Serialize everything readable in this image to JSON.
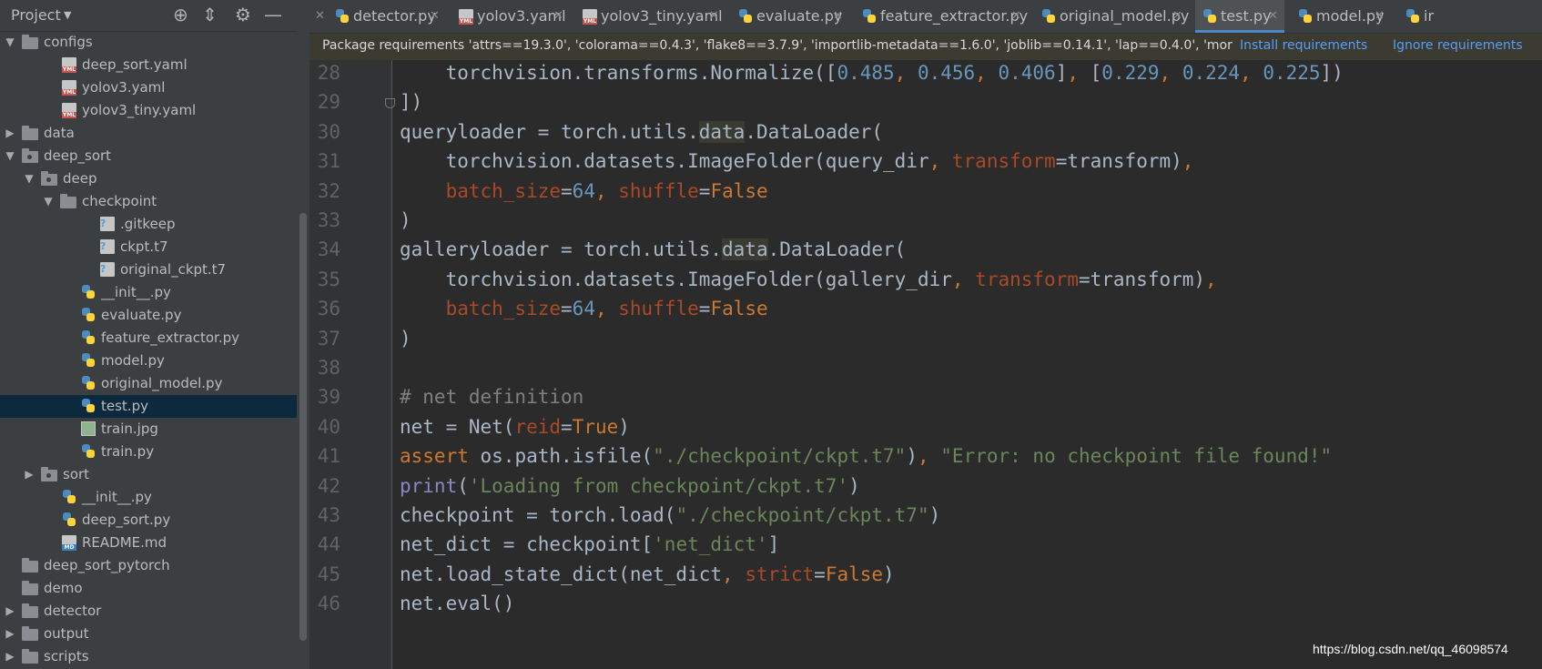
{
  "sidebar": {
    "title": "Project",
    "tree": [
      {
        "label": "configs",
        "type": "folder",
        "expanded": true
      },
      {
        "label": "deep_sort.yaml",
        "type": "yaml"
      },
      {
        "label": "yolov3.yaml",
        "type": "yaml"
      },
      {
        "label": "yolov3_tiny.yaml",
        "type": "yaml"
      },
      {
        "label": "data",
        "type": "folder",
        "expanded": false
      },
      {
        "label": "deep_sort",
        "type": "package",
        "expanded": true
      },
      {
        "label": "deep",
        "type": "package",
        "expanded": true
      },
      {
        "label": "checkpoint",
        "type": "folder",
        "expanded": true
      },
      {
        "label": ".gitkeep",
        "type": "unknown"
      },
      {
        "label": "ckpt.t7",
        "type": "unknown"
      },
      {
        "label": "original_ckpt.t7",
        "type": "unknown"
      },
      {
        "label": "__init__.py",
        "type": "python"
      },
      {
        "label": "evaluate.py",
        "type": "python"
      },
      {
        "label": "feature_extractor.py",
        "type": "python"
      },
      {
        "label": "model.py",
        "type": "python"
      },
      {
        "label": "original_model.py",
        "type": "python"
      },
      {
        "label": "test.py",
        "type": "python",
        "selected": true
      },
      {
        "label": "train.jpg",
        "type": "image"
      },
      {
        "label": "train.py",
        "type": "python"
      },
      {
        "label": "sort",
        "type": "package",
        "expanded": false
      },
      {
        "label": "__init__.py",
        "type": "python"
      },
      {
        "label": "deep_sort.py",
        "type": "python"
      },
      {
        "label": "README.md",
        "type": "markdown"
      },
      {
        "label": "deep_sort_pytorch",
        "type": "folder"
      },
      {
        "label": "demo",
        "type": "folder"
      },
      {
        "label": "detector",
        "type": "folder",
        "expanded": false
      },
      {
        "label": "output",
        "type": "folder",
        "expanded": false
      },
      {
        "label": "scripts",
        "type": "folder",
        "expanded": false
      }
    ]
  },
  "tabs": [
    {
      "label": "detector.py",
      "type": "python"
    },
    {
      "label": "yolov3.yaml",
      "type": "yaml"
    },
    {
      "label": "yolov3_tiny.yaml",
      "type": "yaml"
    },
    {
      "label": "evaluate.py",
      "type": "python"
    },
    {
      "label": "feature_extractor.py",
      "type": "python"
    },
    {
      "label": "original_model.py",
      "type": "python"
    },
    {
      "label": "test.py",
      "type": "python",
      "active": true
    },
    {
      "label": "model.py",
      "type": "python"
    },
    {
      "label": "ir",
      "type": "python"
    }
  ],
  "banner": {
    "text": "Package requirements 'attrs==19.3.0', 'colorama==0.4.3', 'flake8==3.7.9', 'importlib-metadata==1.6.0', 'joblib==0.14.1', 'lap==0.4.0', 'mor",
    "install": "Install requirements",
    "ignore": "Ignore requirements"
  },
  "code": {
    "lines": [
      {
        "n": "28",
        "tokens": [
          [
            "",
            "    torchvision.transforms.Normalize(["
          ],
          [
            "num",
            "0.485"
          ],
          [
            "kw",
            ", "
          ],
          [
            "num",
            "0.456"
          ],
          [
            "kw",
            ", "
          ],
          [
            "num",
            "0.406"
          ],
          [
            "",
            "]"
          ],
          [
            "kw",
            ", "
          ],
          [
            "",
            "["
          ],
          [
            "num",
            "0.229"
          ],
          [
            "kw",
            ", "
          ],
          [
            "num",
            "0.224"
          ],
          [
            "kw",
            ", "
          ],
          [
            "num",
            "0.225"
          ],
          [
            "",
            "])"
          ]
        ]
      },
      {
        "n": "29",
        "tokens": [
          [
            "",
            "])"
          ]
        ]
      },
      {
        "n": "30",
        "tokens": [
          [
            "",
            "queryloader = torch.utils."
          ],
          [
            "hl",
            "data"
          ],
          [
            "",
            ".DataLoader("
          ]
        ]
      },
      {
        "n": "31",
        "tokens": [
          [
            "",
            "    torchvision.datasets.ImageFolder(query_dir"
          ],
          [
            "kw",
            ", "
          ],
          [
            "kwarg",
            "transform"
          ],
          [
            "",
            "=transform)"
          ],
          [
            "kw",
            ","
          ]
        ]
      },
      {
        "n": "32",
        "tokens": [
          [
            "kwarg",
            "    batch_size"
          ],
          [
            "",
            "="
          ],
          [
            "num",
            "64"
          ],
          [
            "kw",
            ", "
          ],
          [
            "kwarg",
            "shuffle"
          ],
          [
            "",
            "="
          ],
          [
            "kw",
            "False"
          ]
        ]
      },
      {
        "n": "33",
        "tokens": [
          [
            "",
            ")"
          ]
        ]
      },
      {
        "n": "34",
        "tokens": [
          [
            "",
            "galleryloader = torch.utils."
          ],
          [
            "hl",
            "data"
          ],
          [
            "",
            ".DataLoader("
          ]
        ]
      },
      {
        "n": "35",
        "tokens": [
          [
            "",
            "    torchvision.datasets.ImageFolder(gallery_dir"
          ],
          [
            "kw",
            ", "
          ],
          [
            "kwarg",
            "transform"
          ],
          [
            "",
            "=transform)"
          ],
          [
            "kw",
            ","
          ]
        ]
      },
      {
        "n": "36",
        "tokens": [
          [
            "kwarg",
            "    batch_size"
          ],
          [
            "",
            "="
          ],
          [
            "num",
            "64"
          ],
          [
            "kw",
            ", "
          ],
          [
            "kwarg",
            "shuffle"
          ],
          [
            "",
            "="
          ],
          [
            "kw",
            "False"
          ]
        ]
      },
      {
        "n": "37",
        "tokens": [
          [
            "",
            ")"
          ]
        ]
      },
      {
        "n": "38",
        "tokens": []
      },
      {
        "n": "39",
        "tokens": [
          [
            "cmt",
            "# net definition"
          ]
        ]
      },
      {
        "n": "40",
        "tokens": [
          [
            "",
            "net = Net("
          ],
          [
            "kwarg",
            "reid"
          ],
          [
            "",
            "="
          ],
          [
            "kw",
            "True"
          ],
          [
            "",
            ")"
          ]
        ]
      },
      {
        "n": "41",
        "tokens": [
          [
            "kw",
            "assert "
          ],
          [
            "",
            "os.path.isfile("
          ],
          [
            "str",
            "\"./checkpoint/ckpt.t7\""
          ],
          [
            "",
            ")"
          ],
          [
            "kw",
            ", "
          ],
          [
            "str",
            "\"Error: no checkpoint file found!\""
          ]
        ]
      },
      {
        "n": "42",
        "tokens": [
          [
            "bi",
            "print"
          ],
          [
            "",
            "("
          ],
          [
            "str",
            "'Loading from checkpoint/ckpt.t7'"
          ],
          [
            "",
            ")"
          ]
        ]
      },
      {
        "n": "43",
        "tokens": [
          [
            "",
            "checkpoint = torch.load("
          ],
          [
            "str",
            "\"./checkpoint/ckpt.t7\""
          ],
          [
            "",
            ")"
          ]
        ]
      },
      {
        "n": "44",
        "tokens": [
          [
            "",
            "net_dict = checkpoint["
          ],
          [
            "str",
            "'net_dict'"
          ],
          [
            "",
            "]"
          ]
        ]
      },
      {
        "n": "45",
        "tokens": [
          [
            "",
            "net.load_state_dict(net_dict"
          ],
          [
            "kw",
            ", "
          ],
          [
            "kwarg",
            "strict"
          ],
          [
            "",
            "="
          ],
          [
            "kw",
            "False"
          ],
          [
            "",
            ")"
          ]
        ]
      },
      {
        "n": "46",
        "tokens": [
          [
            "",
            "net.eval()"
          ]
        ]
      }
    ]
  },
  "watermark": "https://blog.csdn.net/qq_46098574",
  "colors": {
    "accent": "#4a88c7",
    "selection": "#0d293e",
    "keyword": "#cc7832",
    "number": "#6897bb",
    "string": "#6a8759"
  }
}
